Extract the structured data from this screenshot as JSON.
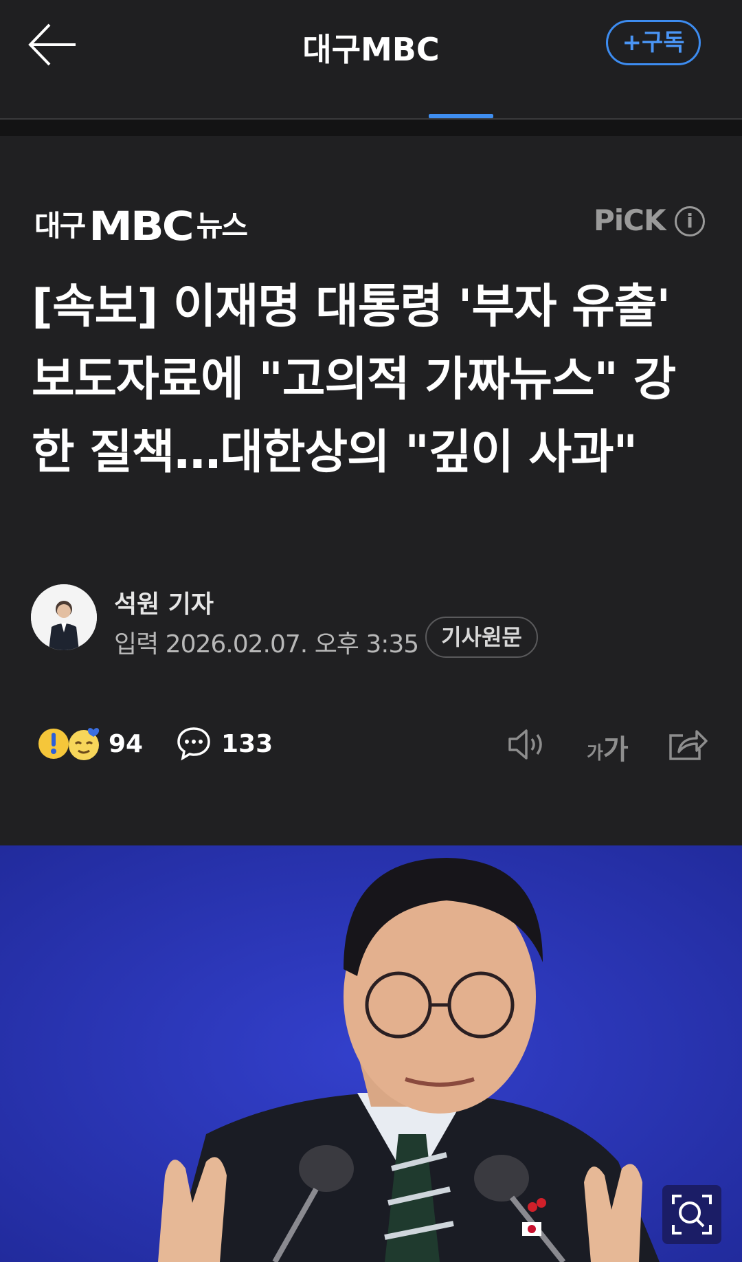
{
  "topbar": {
    "title": "대구MBC",
    "subscribe_label": "+구독"
  },
  "press": {
    "logo_prefix": "대구",
    "logo_mbc": "MBC",
    "logo_suffix": "뉴스",
    "pick_label": "PiCK",
    "info_glyph": "i"
  },
  "article": {
    "headline": "[속보] 이재명 대통령 '부자 유출' 보도자료에 \"고의적 가짜뉴스\" 강한 질책…대한상의 \"깊이 사과\"",
    "reporter": "석원 기자",
    "date": "입력 2026.02.07. 오후 3:35",
    "original_link_label": "기사원문"
  },
  "engagement": {
    "reactions_count": "94",
    "comments_count": "133",
    "font_small": "가",
    "font_big": "가"
  },
  "icons": {
    "back": "arrow-left-icon",
    "info": "info-icon",
    "comment": "speech-bubble-icon",
    "speaker": "speaker-icon",
    "font_size": "font-size-icon",
    "share": "share-icon",
    "zoom": "zoom-search-icon"
  },
  "colors": {
    "accent": "#3d8cf0",
    "background": "#202022",
    "photo_background": "#2a34b8"
  }
}
